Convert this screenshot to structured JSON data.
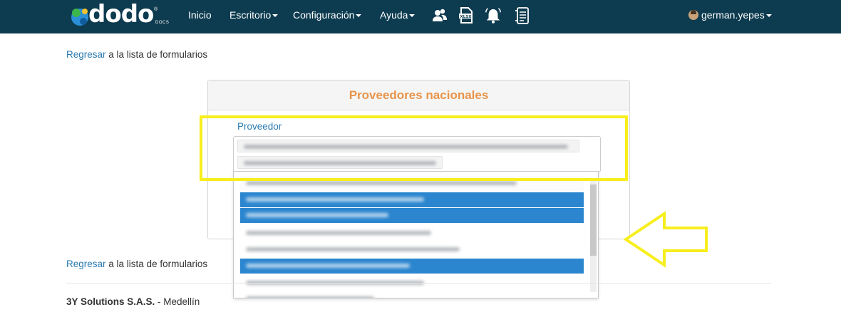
{
  "nav": {
    "logo_text": "dodo",
    "logo_sub": "DOCS",
    "logo_reg": "®",
    "items": [
      {
        "label": "Inicio"
      },
      {
        "label": "Escritorio"
      },
      {
        "label": "Configuración"
      },
      {
        "label": "Ayuda"
      }
    ],
    "icons": [
      "users-icon",
      "xlsx-file-icon",
      "bell-icon",
      "document-list-icon"
    ],
    "user": "german.yepes"
  },
  "links": {
    "back_link": "Regresar",
    "back_suffix": " a la lista de formularios"
  },
  "form": {
    "title": "Proveedores nacionales",
    "field_label": "Proveedor"
  },
  "footer": {
    "company": "3Y Solutions S.A.S.",
    "separator": " - ",
    "city": "Medellín"
  },
  "colors": {
    "navbar": "#0d3b4f",
    "link": "#2a7ab0",
    "title": "#e8944a",
    "highlight": "#f7ee1e",
    "selected_option": "#2b86cf"
  }
}
